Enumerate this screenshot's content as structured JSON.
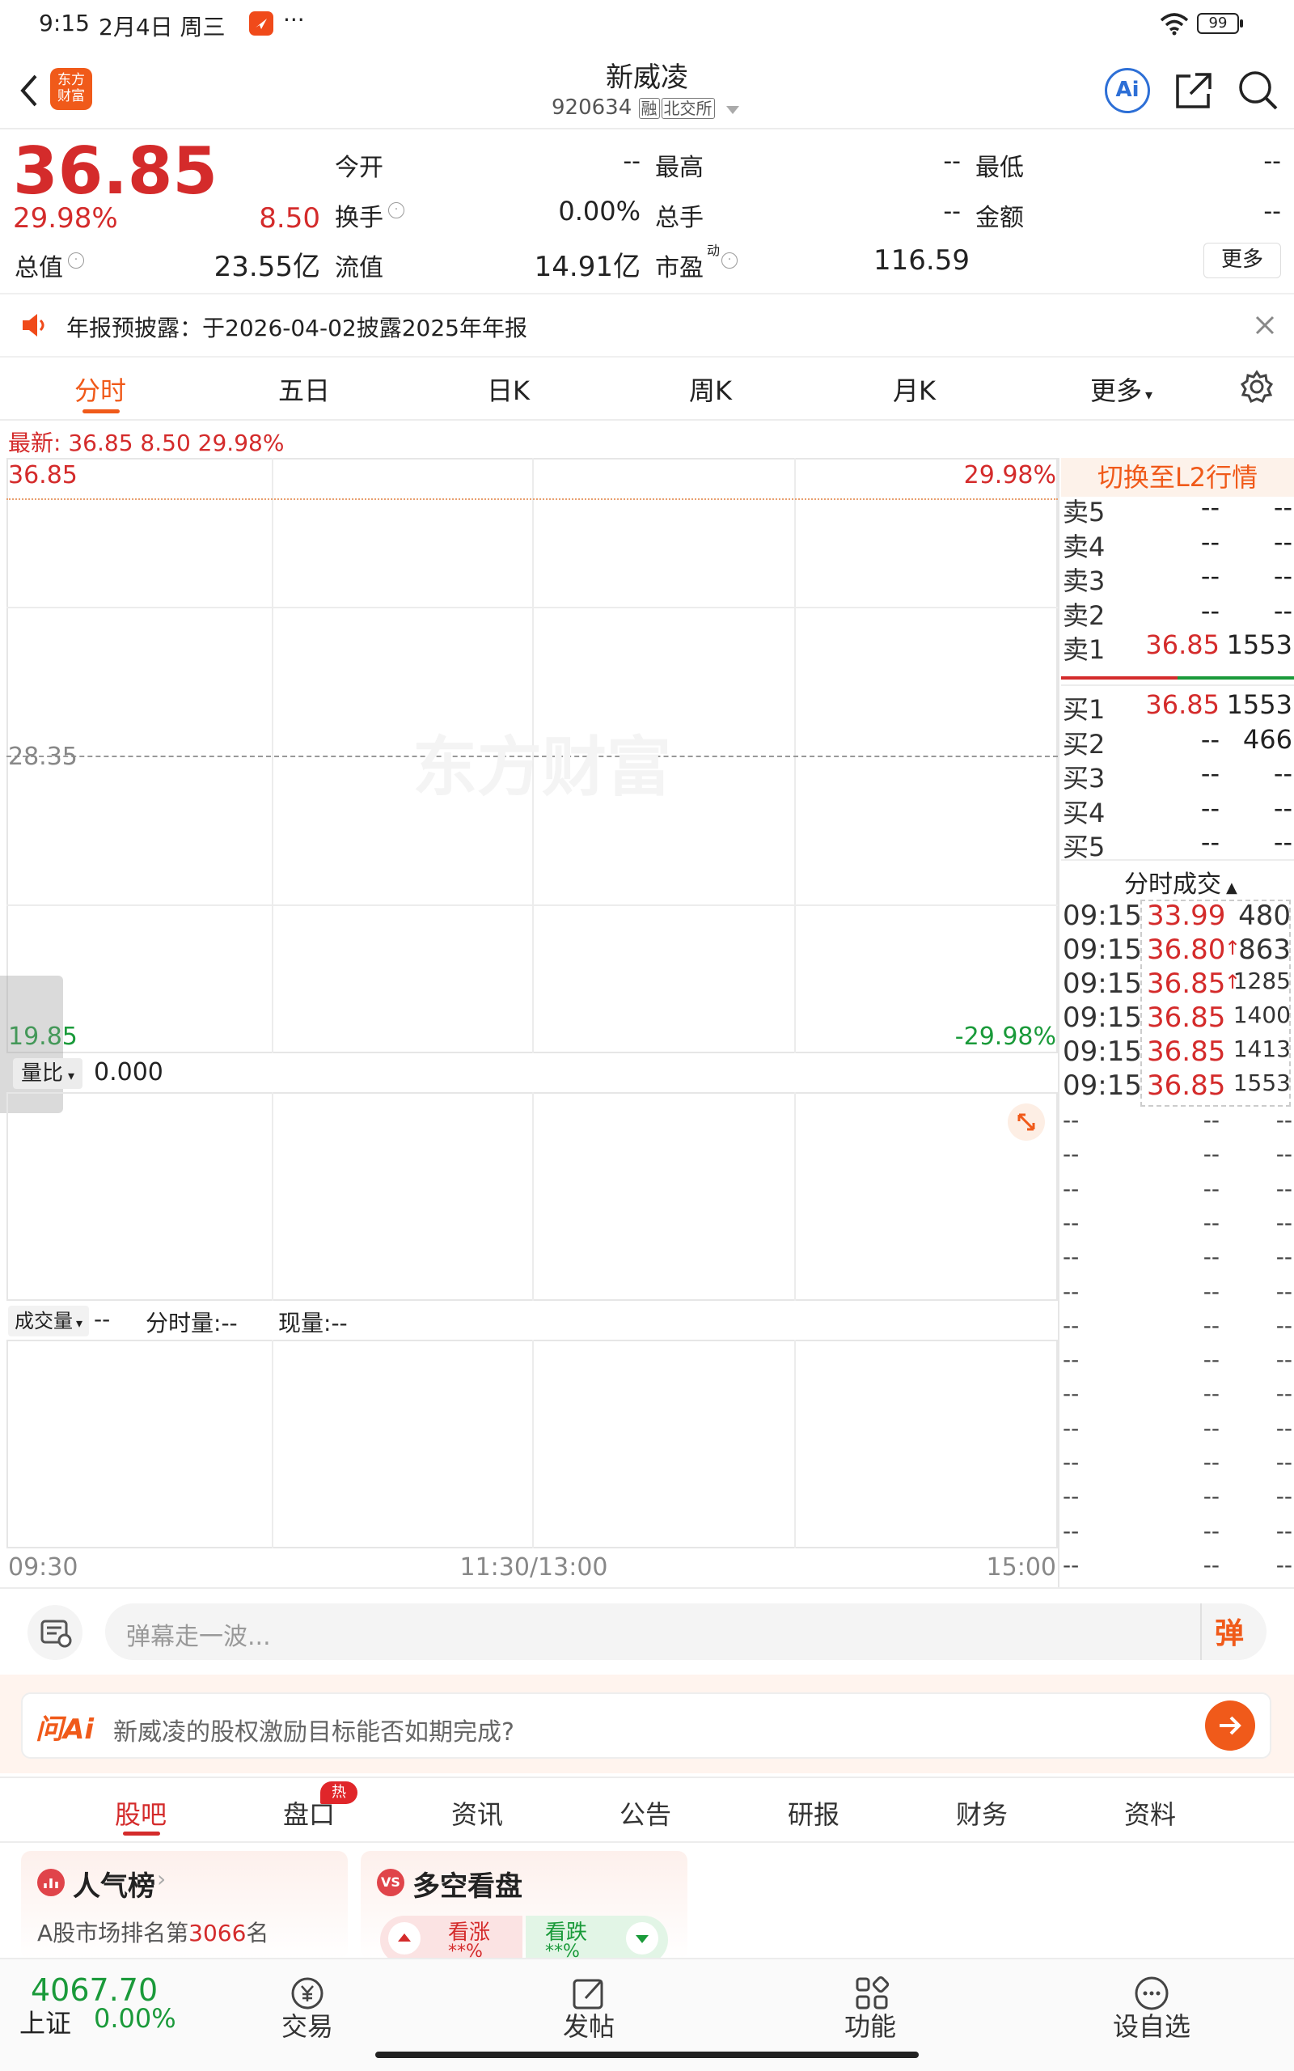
{
  "status_bar": {
    "time": "9:15",
    "date": "2月4日 周三",
    "more": "···",
    "battery": "99"
  },
  "header": {
    "logo_text": "东方\n财富",
    "title": "新威凌",
    "code": "920634",
    "tag1": "融",
    "tag2": "北交所"
  },
  "quote": {
    "price": "36.85",
    "change_pct": "29.98%",
    "change": "8.50",
    "fields": [
      {
        "label": "今开",
        "value": "--"
      },
      {
        "label": "最高",
        "value": "--"
      },
      {
        "label": "最低",
        "value": "--"
      },
      {
        "label": "换手",
        "value": "0.00%"
      },
      {
        "label": "总手",
        "value": "--"
      },
      {
        "label": "金额",
        "value": "--"
      }
    ],
    "total_value_label": "总值",
    "total_value": "23.55亿",
    "float_value_label": "流值",
    "float_value": "14.91亿",
    "pe_label": "市盈",
    "pe_sup": "动",
    "pe_value": "116.59",
    "more_button": "更多"
  },
  "notice": {
    "text": "年报预披露：于2026-04-02披露2025年年报"
  },
  "tabs": [
    "分时",
    "五日",
    "日K",
    "周K",
    "月K",
    "更多"
  ],
  "chart_info": {
    "label": "最新:",
    "price": "36.85",
    "change": "8.50",
    "pct": "29.98%"
  },
  "chart_data": {
    "type": "line",
    "ylabels_left": [
      "36.85",
      "28.35",
      "19.85"
    ],
    "ylabels_right": [
      "29.98%",
      "-29.98%"
    ],
    "xlabels": [
      "09:30",
      "11:30/13:00",
      "15:00"
    ],
    "watermark": "东方财富",
    "series": []
  },
  "sub_chart": {
    "selector": "量比",
    "value": "0.000"
  },
  "volume_chart": {
    "selector": "成交量",
    "value": "--",
    "period_label": "分时量:",
    "period_value": "--",
    "now_label": "现量:",
    "now_value": "--"
  },
  "order_book": {
    "switch_label": "切换至L2行情",
    "asks": [
      {
        "label": "卖5",
        "price": "--",
        "vol": "--"
      },
      {
        "label": "卖4",
        "price": "--",
        "vol": "--"
      },
      {
        "label": "卖3",
        "price": "--",
        "vol": "--"
      },
      {
        "label": "卖2",
        "price": "--",
        "vol": "--"
      },
      {
        "label": "卖1",
        "price": "36.85",
        "vol": "1553"
      }
    ],
    "bids": [
      {
        "label": "买1",
        "price": "36.85",
        "vol": "1553"
      },
      {
        "label": "买2",
        "price": "--",
        "vol": "466"
      },
      {
        "label": "买3",
        "price": "--",
        "vol": "--"
      },
      {
        "label": "买4",
        "price": "--",
        "vol": "--"
      },
      {
        "label": "买5",
        "price": "--",
        "vol": "--"
      }
    ],
    "ticks_label": "分时成交",
    "ticks": [
      {
        "time": "09:15",
        "price": "33.99",
        "vol": "480",
        "arrow": ""
      },
      {
        "time": "09:15",
        "price": "36.80",
        "vol": "863",
        "arrow": "↑"
      },
      {
        "time": "09:15",
        "price": "36.85",
        "vol": "1285",
        "arrow": "↑"
      },
      {
        "time": "09:15",
        "price": "36.85",
        "vol": "1400",
        "arrow": ""
      },
      {
        "time": "09:15",
        "price": "36.85",
        "vol": "1413",
        "arrow": ""
      },
      {
        "time": "09:15",
        "price": "36.85",
        "vol": "1553",
        "arrow": ""
      }
    ],
    "empty_dash": "--"
  },
  "danmaku": {
    "placeholder": "弹幕走一波...",
    "button": "弹"
  },
  "ask_ai": {
    "logo": "问Ai",
    "question": "新威凌的股权激励目标能否如期完成?"
  },
  "bottom_tabs": [
    "股吧",
    "盘口",
    "资讯",
    "公告",
    "研报",
    "财务",
    "资料"
  ],
  "hot_badge": "热",
  "cards": {
    "popularity": {
      "title": "人气榜",
      "rank_prefix": "A股市场排名第",
      "rank": "3066",
      "rank_suffix": "名"
    },
    "bull_bear": {
      "title": "多空看盘",
      "up": "看涨",
      "down": "看跌",
      "up_val": "**%",
      "down_val": "**%"
    }
  },
  "bottom_nav": {
    "index_value": "4067.70",
    "index_name": "上证",
    "index_change": "0.00%",
    "items": [
      "交易",
      "发帖",
      "功能",
      "设自选"
    ]
  },
  "colors": {
    "up": "#d42b2b",
    "down": "#1a9a3a",
    "accent": "#f05a1a"
  }
}
